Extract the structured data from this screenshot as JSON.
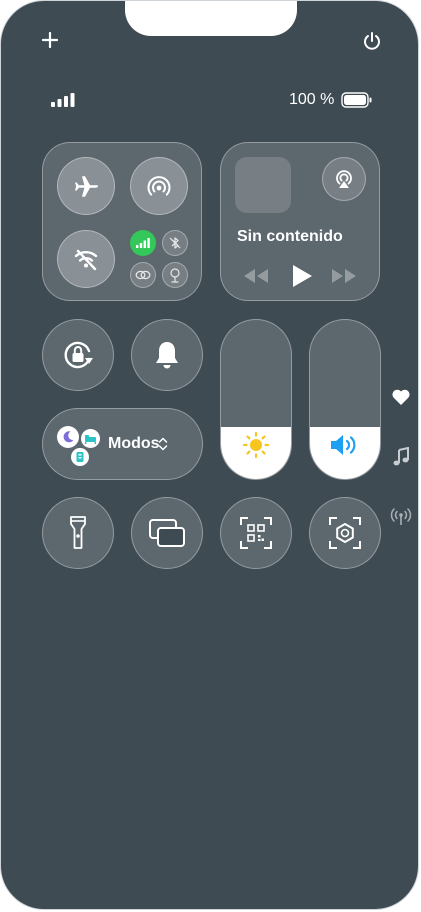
{
  "status_bar": {
    "battery_text": "100 %",
    "battery_level_percent": 100
  },
  "top_bar": {
    "add_icon": "plus-icon",
    "power_icon": "power-icon"
  },
  "connectivity": {
    "airplane_icon": "airplane-icon",
    "airdrop_icon": "airdrop-icon",
    "wifi_icon": "wifi-off-icon",
    "cellular_icon": "cellular-icon",
    "cellular_color": "#34c759",
    "bluetooth_icon": "bluetooth-off-icon",
    "link_icon": "personal-hotspot-icon",
    "focus_tree_icon": "satellite-icon"
  },
  "media": {
    "title": "Sin contenido",
    "airplay_icon": "airplay-icon",
    "prev_icon": "rewind-icon",
    "play_icon": "play-icon",
    "next_icon": "forward-icon"
  },
  "controls": {
    "rotation_lock_icon": "rotation-lock-icon",
    "bell_icon": "bell-icon",
    "modes_label": "Modos",
    "modes_chevron": "⌃⌄"
  },
  "sliders": {
    "brightness_level_percent": 33,
    "brightness_color": "#f7c51e",
    "volume_level_percent": 33,
    "volume_color": "#1ea0f2"
  },
  "bottom_row": {
    "flashlight_icon": "flashlight-icon",
    "mirror_icon": "screen-mirroring-icon",
    "qr_icon": "qr-code-icon",
    "camera_icon": "camera-aperture-icon"
  },
  "side_icons": {
    "heart_icon": "heart-icon",
    "music_icon": "music-note-icon",
    "signal_icon": "antenna-icon"
  }
}
